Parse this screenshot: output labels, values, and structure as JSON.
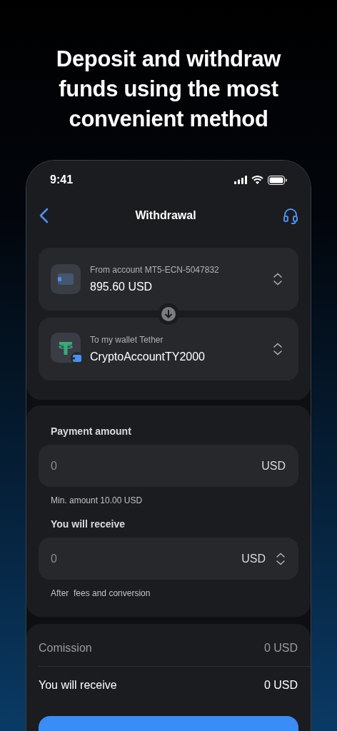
{
  "headline": "Deposit and withdraw funds using the most convenient method",
  "status_bar": {
    "time": "9:41"
  },
  "nav": {
    "title": "Withdrawal"
  },
  "accounts": [
    {
      "kind": "account",
      "caption": "From account MT5-ECN-5047832",
      "value": "895.60 USD"
    },
    {
      "kind": "wallet",
      "caption": "To my wallet Tether",
      "value": "CryptoAccountTY2000"
    }
  ],
  "payment": {
    "label": "Payment amount",
    "placeholder": "0",
    "currency": "USD",
    "hint": "Min. amount 10.00 USD",
    "selectable": false
  },
  "receive": {
    "label": "You will receive",
    "placeholder": "0",
    "currency": "USD",
    "hint": "After  fees and conversion",
    "selectable": true
  },
  "summary": [
    {
      "kind": "fee",
      "label": "Comission",
      "value": "0 USD"
    },
    {
      "kind": "total",
      "label": "You will receive",
      "value": "0 USD"
    }
  ]
}
